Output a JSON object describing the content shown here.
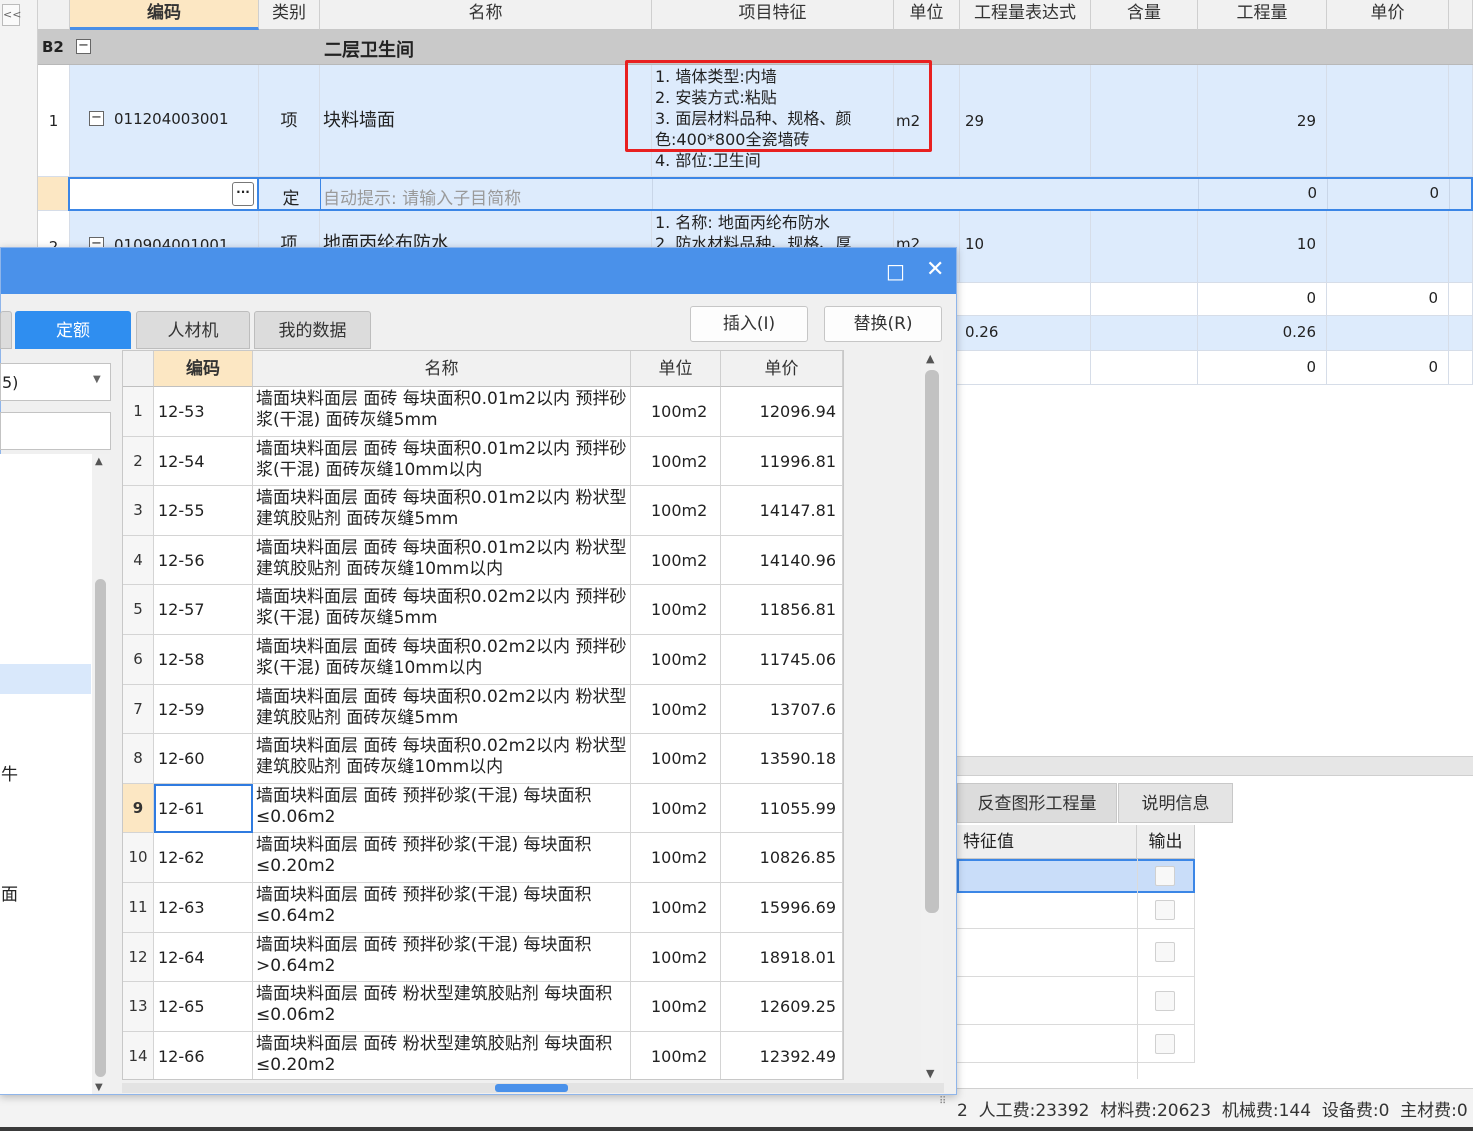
{
  "main": {
    "collapse_left": "<<",
    "headers": [
      "编码",
      "类别",
      "名称",
      "项目特征",
      "单位",
      "工程量表达式",
      "含量",
      "工程量",
      "单价"
    ],
    "section": {
      "code": "B2",
      "toggle": "−",
      "name": "二层卫生间"
    },
    "row1": {
      "index": "1",
      "toggle": "−",
      "code": "011204003001",
      "type": "项",
      "name": "块料墙面",
      "features": [
        "1. 墙体类型:内墙",
        "2. 安装方式:粘贴",
        "3. 面层材料品种、规格、颜",
        "色:400*800全瓷墙砖",
        "4. 部位:卫生间"
      ],
      "unit": "m2",
      "expr": "29",
      "qty": "29"
    },
    "input_row": {
      "ellipsis": "···",
      "type": "定",
      "hint": "自动提示: 请输入子目简称",
      "qty": "0",
      "price": "0"
    },
    "row2": {
      "index": "2",
      "toggle": "−",
      "code": "010904001001",
      "type": "项",
      "name": "地面丙纶布防水",
      "features": [
        "1. 名称: 地面丙纶布防水",
        "2. 防水材料品种、规格、厚"
      ],
      "unit": "m2",
      "expr": "10",
      "qty": "10"
    },
    "extra_rows": [
      {
        "expr": "",
        "qty": "0",
        "price": "0"
      },
      {
        "expr": "0.26",
        "qty": "0.26",
        "price": ""
      },
      {
        "expr": "",
        "qty": "0",
        "price": "0"
      }
    ]
  },
  "dialog": {
    "maximize_icon": "□",
    "close_icon": "✕",
    "tabs": [
      "定额",
      "人材机",
      "我的数据"
    ],
    "active_tab": "定额",
    "insert_label": "插入(I)",
    "replace_label": "替换(R)",
    "left_select_value": "5)",
    "left_items": [
      "牛",
      "面"
    ],
    "table": {
      "headers": [
        "编码",
        "名称",
        "单位",
        "单价"
      ],
      "rows": [
        {
          "no": "1",
          "code": "12-53",
          "name": "墙面块料面层 面砖 每块面积0.01m2以内 预拌砂浆(干混) 面砖灰缝5mm",
          "unit": "100m2",
          "price": "12096.94"
        },
        {
          "no": "2",
          "code": "12-54",
          "name": "墙面块料面层 面砖 每块面积0.01m2以内 预拌砂浆(干混) 面砖灰缝10mm以内",
          "unit": "100m2",
          "price": "11996.81"
        },
        {
          "no": "3",
          "code": "12-55",
          "name": "墙面块料面层 面砖 每块面积0.01m2以内 粉状型建筑胶贴剂 面砖灰缝5mm",
          "unit": "100m2",
          "price": "14147.81"
        },
        {
          "no": "4",
          "code": "12-56",
          "name": "墙面块料面层 面砖 每块面积0.01m2以内 粉状型建筑胶贴剂 面砖灰缝10mm以内",
          "unit": "100m2",
          "price": "14140.96"
        },
        {
          "no": "5",
          "code": "12-57",
          "name": "墙面块料面层 面砖 每块面积0.02m2以内 预拌砂浆(干混) 面砖灰缝5mm",
          "unit": "100m2",
          "price": "11856.81"
        },
        {
          "no": "6",
          "code": "12-58",
          "name": "墙面块料面层 面砖 每块面积0.02m2以内 预拌砂浆(干混) 面砖灰缝10mm以内",
          "unit": "100m2",
          "price": "11745.06"
        },
        {
          "no": "7",
          "code": "12-59",
          "name": "墙面块料面层 面砖 每块面积0.02m2以内 粉状型建筑胶贴剂 面砖灰缝5mm",
          "unit": "100m2",
          "price": "13707.6"
        },
        {
          "no": "8",
          "code": "12-60",
          "name": "墙面块料面层 面砖 每块面积0.02m2以内 粉状型建筑胶贴剂 面砖灰缝10mm以内",
          "unit": "100m2",
          "price": "13590.18"
        },
        {
          "no": "9",
          "code": "12-61",
          "name": "墙面块料面层 面砖 预拌砂浆(干混) 每块面积≤0.06m2",
          "unit": "100m2",
          "price": "11055.99"
        },
        {
          "no": "10",
          "code": "12-62",
          "name": "墙面块料面层 面砖 预拌砂浆(干混) 每块面积≤0.20m2",
          "unit": "100m2",
          "price": "10826.85"
        },
        {
          "no": "11",
          "code": "12-63",
          "name": "墙面块料面层 面砖 预拌砂浆(干混) 每块面积≤0.64m2",
          "unit": "100m2",
          "price": "15996.69"
        },
        {
          "no": "12",
          "code": "12-64",
          "name": "墙面块料面层 面砖 预拌砂浆(干混) 每块面积>0.64m2",
          "unit": "100m2",
          "price": "18918.01"
        },
        {
          "no": "13",
          "code": "12-65",
          "name": "墙面块料面层 面砖 粉状型建筑胶贴剂 每块面积 ≤0.06m2",
          "unit": "100m2",
          "price": "12609.25"
        },
        {
          "no": "14",
          "code": "12-66",
          "name": "墙面块料面层 面砖 粉状型建筑胶贴剂 每块面积 ≤0.20m2",
          "unit": "100m2",
          "price": "12392.49"
        }
      ],
      "selected_no": "9"
    }
  },
  "panel": {
    "tabs": [
      "反查图形工程量",
      "说明信息"
    ],
    "headers": [
      "特征值",
      "输出"
    ]
  },
  "status": {
    "text": "2  人工费:23392  材料费:20623  机械费:144  设备费:0  主材费:0"
  }
}
